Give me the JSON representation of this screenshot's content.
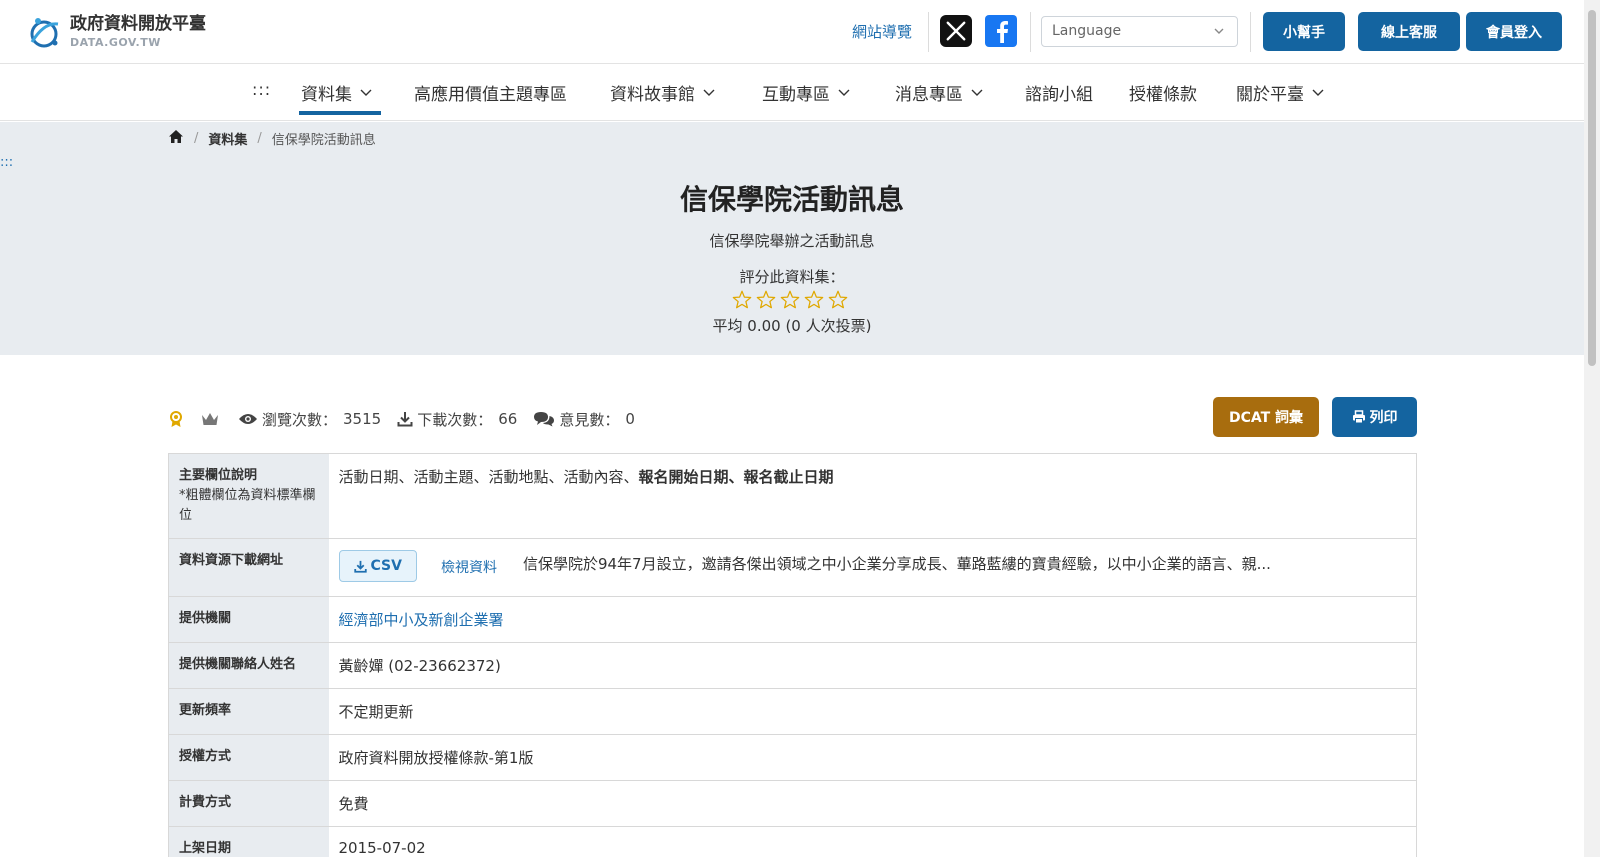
{
  "header": {
    "logo_zh": "政府資料開放平臺",
    "logo_en": "DATA.GOV.TW",
    "sitemap": "網站導覽",
    "language_placeholder": "Language",
    "helper_btn": "小幫手",
    "service_btn": "線上客服",
    "login_btn": "會員登入"
  },
  "nav": {
    "dots": ":::",
    "items": [
      "資料集",
      "高應用價值主題專區",
      "資料故事館",
      "互動專區",
      "消息專區",
      "諮詢小組",
      "授權條款",
      "關於平臺"
    ]
  },
  "breadcrumb": {
    "datasets": "資料集",
    "current": "信保學院活動訊息"
  },
  "side_dots": ":::",
  "dataset": {
    "title": "信保學院活動訊息",
    "subtitle": "信保學院舉辦之活動訊息",
    "rate_label": "評分此資料集：",
    "rating_value": 0,
    "rating_max": 5,
    "rating_avg": "平均 0.00 (0 人次投票)"
  },
  "stats": {
    "views_label": "瀏覽次數：",
    "views": "3515",
    "downloads_label": "下載次數：",
    "downloads": "66",
    "comments_label": "意見數：",
    "comments": "0"
  },
  "actions": {
    "dcat": "DCAT 詞彙",
    "print": "列印"
  },
  "table": {
    "main_fields_label": "主要欄位說明",
    "main_fields_note": "*粗體欄位為資料標準欄位",
    "main_fields_plain": "活動日期、活動主題、活動地點、活動內容、",
    "main_fields_bold": "報名開始日期、報名截止日期",
    "resource_label": "資料資源下載網址",
    "resource_format": "CSV",
    "resource_view": "檢視資料",
    "resource_desc": "信保學院於94年7月設立，邀請各傑出領域之中小企業分享成長、蓽路藍縷的寶貴經驗，以中小企業的語言、親...",
    "provider_label": "提供機關",
    "provider": "經濟部中小及新創企業署",
    "contact_label": "提供機關聯絡人姓名",
    "contact": "黃齡嬋 (02-23662372)",
    "frequency_label": "更新頻率",
    "frequency": "不定期更新",
    "license_label": "授權方式",
    "license": "政府資料開放授權條款-第1版",
    "fee_label": "計費方式",
    "fee": "免費",
    "published_label": "上架日期",
    "published": "2015-07-02"
  },
  "colors": {
    "primary": "#1464a0",
    "dcat": "#a86d0e",
    "hero_bg": "#e8ecf0",
    "star": "#e0a800"
  }
}
